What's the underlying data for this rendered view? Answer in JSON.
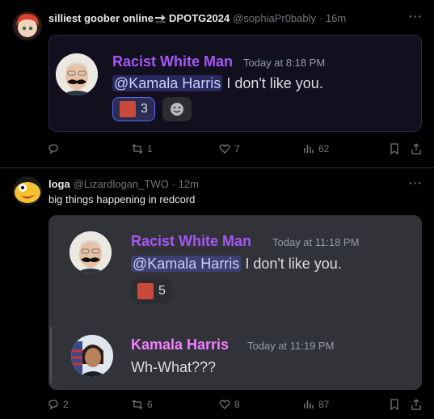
{
  "colors": {
    "purple_name": "#a855f7",
    "pink_name": "#f47fff",
    "bg": "#000000",
    "muted": "#71767b"
  },
  "tweet1": {
    "display_name": "silliest goober online",
    "name_suffix": "DPOTG2024",
    "handle": "@sophiaPr0bably",
    "time": "· 16m",
    "more": "···",
    "embed": {
      "author": "Racist White Man",
      "timestamp": "Today at 8:18 PM",
      "mention": "@Kamala Harris",
      "message": " I don't like you.",
      "reaction_count": "3"
    },
    "actions": {
      "replies": "",
      "reposts": "1",
      "likes": "7",
      "views": "62"
    }
  },
  "tweet2": {
    "display_name": "loga",
    "handle": "@Lizardlogan_TWO",
    "time": "· 12m",
    "more": "···",
    "text": "big things happening in redcord",
    "embed": {
      "msg1": {
        "author": "Racist White Man",
        "timestamp": "Today at 11:18 PM",
        "mention": "@Kamala Harris",
        "message": " I don't like you.",
        "reaction_count": "5"
      },
      "msg2": {
        "author": "Kamala Harris",
        "timestamp": "Today at 11:19 PM",
        "message": "Wh-What???"
      }
    },
    "actions": {
      "replies": "2",
      "reposts": "6",
      "likes": "8",
      "views": "87"
    }
  },
  "icons": [
    "reply-icon",
    "repost-icon",
    "like-icon",
    "views-icon",
    "bookmark-icon",
    "share-icon",
    "add-reaction-icon"
  ]
}
